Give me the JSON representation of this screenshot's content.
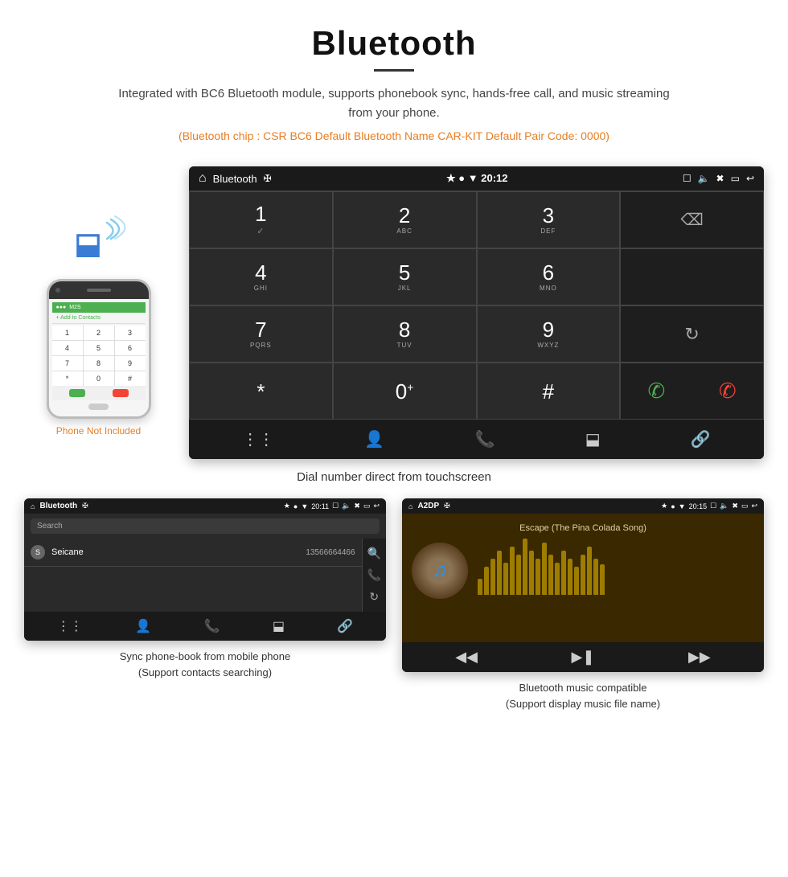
{
  "page": {
    "title": "Bluetooth",
    "subtitle": "Integrated with BC6 Bluetooth module, supports phonebook sync, hands-free call, and music streaming from your phone.",
    "specs": "(Bluetooth chip : CSR BC6    Default Bluetooth Name CAR-KIT    Default Pair Code: 0000)",
    "caption_dialer": "Dial number direct from touchscreen",
    "caption_phonebook": "Sync phone-book from mobile phone\n(Support contacts searching)",
    "caption_music": "Bluetooth music compatible\n(Support display music file name)"
  },
  "dialer_screen": {
    "status_title": "Bluetooth",
    "time": "20:12",
    "keys": [
      {
        "num": "1",
        "sub": ""
      },
      {
        "num": "2",
        "sub": "ABC"
      },
      {
        "num": "3",
        "sub": "DEF"
      },
      {
        "num": "4",
        "sub": "GHI"
      },
      {
        "num": "5",
        "sub": "JKL"
      },
      {
        "num": "6",
        "sub": "MNO"
      },
      {
        "num": "7",
        "sub": "PQRS"
      },
      {
        "num": "8",
        "sub": "TUV"
      },
      {
        "num": "9",
        "sub": "WXYZ"
      },
      {
        "num": "*",
        "sub": ""
      },
      {
        "num": "0",
        "sub": "+"
      },
      {
        "num": "#",
        "sub": ""
      }
    ]
  },
  "phonebook_screen": {
    "status_title": "Bluetooth",
    "time": "20:11",
    "search_placeholder": "Search",
    "contact_name": "Seicane",
    "contact_phone": "13566664466"
  },
  "music_screen": {
    "status_title": "A2DP",
    "time": "20:15",
    "song_title": "Escape (The Pina Colada Song)"
  },
  "phone_label": "Phone Not Included",
  "equalizer_bars": [
    20,
    35,
    45,
    55,
    40,
    60,
    50,
    70,
    55,
    45,
    65,
    50,
    40,
    55,
    45,
    35,
    50,
    60,
    45,
    38
  ]
}
